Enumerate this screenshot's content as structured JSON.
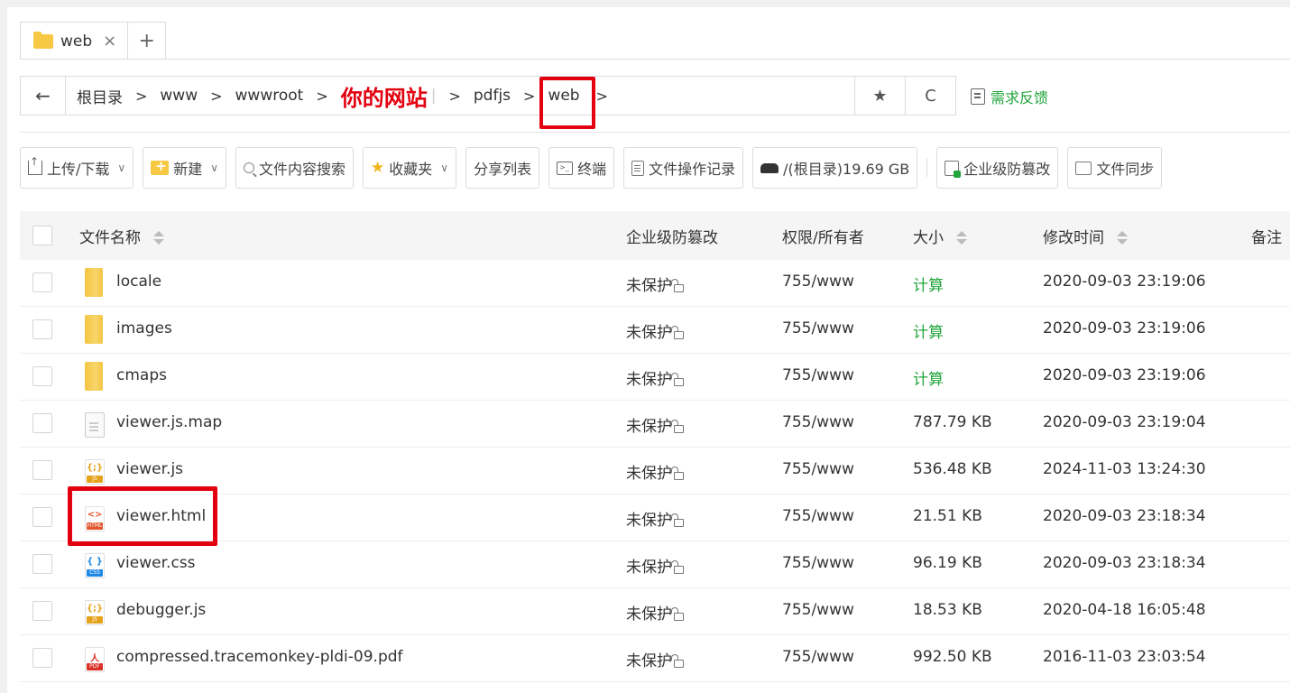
{
  "tab": {
    "label": "web",
    "close": "×",
    "add": "+"
  },
  "path": {
    "back": "←",
    "crumbs": [
      "根目录",
      "www",
      "wwwroot",
      "你的网站",
      "pdfjs",
      "web"
    ],
    "separator": ">",
    "pipe": "|",
    "star": "★",
    "refresh": "C"
  },
  "feedback": "需求反馈",
  "toolbar": {
    "upload": "上传/下载",
    "new": "新建",
    "search": "文件内容搜索",
    "favorites": "收藏夹",
    "share": "分享列表",
    "terminal": "终端",
    "terminal_glyph": ">_",
    "oplog": "文件操作记录",
    "disk": "/(根目录)19.69 GB",
    "tamper": "企业级防篡改",
    "sync": "文件同步",
    "chevron": "∨"
  },
  "columns": {
    "name": "文件名称",
    "tamper": "企业级防篡改",
    "perm": "权限/所有者",
    "size": "大小",
    "mtime": "修改时间",
    "note": "备注"
  },
  "files": [
    {
      "name": "locale",
      "icon": "folder-icon",
      "tamper": "未保护",
      "perm": "755/www",
      "size": "计算",
      "mtime": "2020-09-03 23:19:06"
    },
    {
      "name": "images",
      "icon": "folder-icon",
      "tamper": "未保护",
      "perm": "755/www",
      "size": "计算",
      "mtime": "2020-09-03 23:19:06"
    },
    {
      "name": "cmaps",
      "icon": "folder-icon",
      "tamper": "未保护",
      "perm": "755/www",
      "size": "计算",
      "mtime": "2020-09-03 23:19:06"
    },
    {
      "name": "viewer.js.map",
      "icon": "file-icon",
      "tamper": "未保护",
      "perm": "755/www",
      "size": "787.79 KB",
      "mtime": "2020-09-03 23:19:04"
    },
    {
      "name": "viewer.js",
      "icon": "js-file-icon",
      "tamper": "未保护",
      "perm": "755/www",
      "size": "536.48 KB",
      "mtime": "2024-11-03 13:24:30"
    },
    {
      "name": "viewer.html",
      "icon": "html-file-icon",
      "tamper": "未保护",
      "perm": "755/www",
      "size": "21.51 KB",
      "mtime": "2020-09-03 23:18:34"
    },
    {
      "name": "viewer.css",
      "icon": "css-file-icon",
      "tamper": "未保护",
      "perm": "755/www",
      "size": "96.19 KB",
      "mtime": "2020-09-03 23:18:34"
    },
    {
      "name": "debugger.js",
      "icon": "js-file-icon",
      "tamper": "未保护",
      "perm": "755/www",
      "size": "18.53 KB",
      "mtime": "2020-04-18 16:05:48"
    },
    {
      "name": "compressed.tracemonkey-pldi-09.pdf",
      "icon": "pdf-file-icon",
      "tamper": "未保护",
      "perm": "755/www",
      "size": "992.50 KB",
      "mtime": "2016-11-03 23:03:54"
    }
  ],
  "icon_labels": {
    "js": "JS",
    "js_mark": "{;}",
    "html": "HTML",
    "html_mark": "<>",
    "css": "CSS",
    "css_mark": "{ }",
    "pdf": "PDF",
    "pdf_mark": "人"
  },
  "colors": {
    "accent": "#20a53a",
    "highlight": "#e3000f",
    "folder": "#f6c844"
  }
}
